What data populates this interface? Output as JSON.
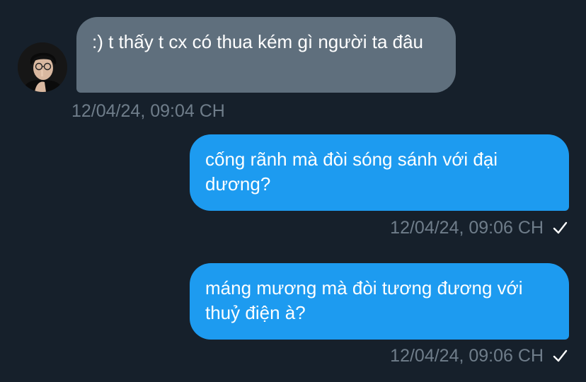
{
  "messages": [
    {
      "direction": "incoming",
      "text": ":) t thấy t cx có thua kém gì người ta đâu",
      "timestamp": "12/04/24, 09:04 CH",
      "avatar_icon": "user-avatar"
    },
    {
      "direction": "outgoing",
      "text": "cống rãnh mà đòi sóng sánh với đại dương?",
      "timestamp": "12/04/24, 09:06 CH",
      "status_icon": "checkmark-icon"
    },
    {
      "direction": "outgoing",
      "text": "máng mương mà đòi tương đương với thuỷ điện à?",
      "timestamp": "12/04/24, 09:06 CH",
      "status_icon": "checkmark-icon"
    }
  ],
  "colors": {
    "background": "#16202b",
    "incoming_bubble": "#5f6f7d",
    "outgoing_bubble": "#1d9bf0",
    "timestamp": "#6f7d8a",
    "text": "#ffffff"
  }
}
